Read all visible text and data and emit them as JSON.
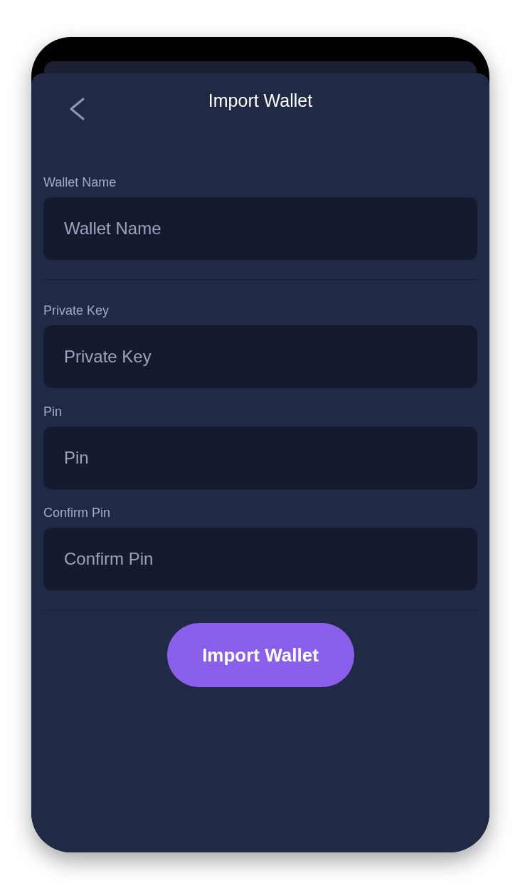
{
  "header": {
    "title": "Import Wallet"
  },
  "sections": [
    {
      "fields": [
        {
          "label": "Wallet Name",
          "placeholder": "Wallet Name"
        }
      ]
    },
    {
      "fields": [
        {
          "label": "Private Key",
          "placeholder": "Private Key"
        },
        {
          "label": "Pin",
          "placeholder": "Pin"
        },
        {
          "label": "Confirm Pin",
          "placeholder": "Confirm Pin"
        }
      ]
    }
  ],
  "button": {
    "label": "Import Wallet"
  }
}
